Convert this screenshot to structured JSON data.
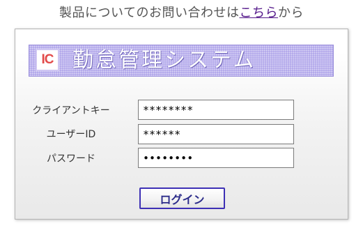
{
  "header": {
    "contact_prefix": "製品についてのお問い合わせは",
    "contact_link": "こちら",
    "contact_suffix": "から"
  },
  "banner": {
    "logo_text": "IC",
    "title": "勤怠管理システム"
  },
  "form": {
    "client_key": {
      "label": "クライアントキー",
      "value": "********"
    },
    "user_id": {
      "label": "ユーザーID",
      "value": "******"
    },
    "password": {
      "label": "パスワード",
      "value": "••••••••"
    },
    "login_label": "ログイン"
  },
  "colors": {
    "banner": "#b0a6ea",
    "logo_text": "#e24a4a",
    "link": "#551a8b",
    "login_border": "#3d30b5"
  }
}
